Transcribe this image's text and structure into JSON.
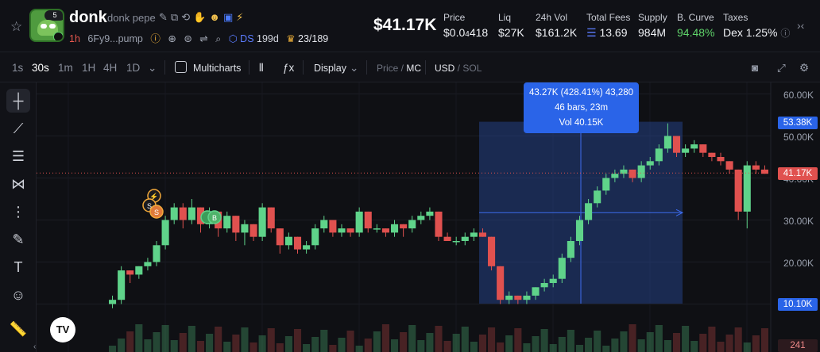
{
  "token": {
    "name": "donk",
    "full_name": "donk pepe",
    "avatar_badge": "5",
    "age": "1h",
    "address": "6Fy9...pump",
    "dex_label": "DS",
    "dex_value": "199d",
    "holders": "23/189"
  },
  "market_cap": "$41.17K",
  "stats": [
    {
      "label": "Price",
      "value_main": "$0.0",
      "value_sub": "4",
      "value_tail": "418"
    },
    {
      "label": "Liq",
      "value": "$27K"
    },
    {
      "label": "24h Vol",
      "value": "$161.2K"
    },
    {
      "label": "Total Fees",
      "value": "13.69",
      "icon": "sol-icon"
    },
    {
      "label": "Supply",
      "value": "984M"
    },
    {
      "label": "B. Curve",
      "value": "94.48%",
      "color": "#5fd36a"
    },
    {
      "label": "Taxes",
      "value": "Dex 1.25%"
    }
  ],
  "toolbar": {
    "timeframes": [
      "1s",
      "30s",
      "1m",
      "1H",
      "4H",
      "1D"
    ],
    "active_timeframe": "30s",
    "multicharts": "Multicharts",
    "display": "Display",
    "price": "Price",
    "mc": "MC",
    "usd": "USD",
    "sol": "SOL"
  },
  "tooltip": {
    "line1": "43.27K (428.41%) 43,280",
    "line2": "46 bars, 23m",
    "line3": "Vol 40.15K"
  },
  "y_axis": {
    "ticks": [
      "60.00K",
      "50.00K",
      "40.00K",
      "30.00K",
      "20.00K"
    ],
    "tag_top": "53.38K",
    "tag_current": "41.17K",
    "tag_bottom": "10.10K",
    "tag_volume": "241"
  },
  "chart_data": {
    "type": "candlestick",
    "y_unit": "USD market cap (K)",
    "ylim": [
      0,
      65
    ],
    "range_measure": {
      "from": 10.1,
      "to": 53.38,
      "change": "43.27K (428.41%) 43,280",
      "bars": 46,
      "duration": "23m",
      "volume": "40.15K"
    },
    "current": 41.17,
    "candles": [
      [
        10,
        12,
        9,
        11
      ],
      [
        11,
        19,
        10,
        18
      ],
      [
        18,
        17,
        15,
        17
      ],
      [
        17,
        19,
        16,
        19
      ],
      [
        19,
        21,
        18,
        20
      ],
      [
        20,
        25,
        19,
        24
      ],
      [
        24,
        31,
        23,
        30
      ],
      [
        30,
        34,
        29,
        33
      ],
      [
        33,
        34,
        28,
        30
      ],
      [
        30,
        35,
        29,
        33
      ],
      [
        33,
        30,
        27,
        29
      ],
      [
        29,
        33,
        28,
        32
      ],
      [
        32,
        30,
        26,
        28
      ],
      [
        28,
        32,
        27,
        31
      ],
      [
        31,
        28,
        25,
        27
      ],
      [
        27,
        30,
        24,
        29
      ],
      [
        29,
        26,
        25,
        26
      ],
      [
        26,
        34,
        25,
        33
      ],
      [
        33,
        29,
        27,
        28
      ],
      [
        28,
        26,
        22,
        24
      ],
      [
        24,
        27,
        23,
        26
      ],
      [
        26,
        23,
        22,
        23
      ],
      [
        23,
        25,
        22,
        24
      ],
      [
        24,
        29,
        23,
        28
      ],
      [
        28,
        31,
        27,
        30
      ],
      [
        30,
        27,
        26,
        27
      ],
      [
        27,
        29,
        26,
        28
      ],
      [
        28,
        27,
        26,
        27
      ],
      [
        27,
        33,
        26,
        32
      ],
      [
        32,
        28,
        27,
        28
      ],
      [
        28,
        29,
        27,
        28
      ],
      [
        28,
        27,
        26,
        27
      ],
      [
        27,
        30,
        26,
        29
      ],
      [
        29,
        28,
        26,
        28
      ],
      [
        28,
        31,
        27,
        30
      ],
      [
        30,
        32,
        29,
        31
      ],
      [
        31,
        33,
        30,
        32
      ],
      [
        32,
        28,
        25,
        26
      ],
      [
        26,
        27,
        25,
        25
      ],
      [
        25,
        26,
        24,
        25
      ],
      [
        25,
        27,
        24,
        26
      ],
      [
        26,
        28,
        25,
        27
      ],
      [
        27,
        28,
        26,
        26
      ],
      [
        26,
        24,
        18,
        19
      ],
      [
        19,
        13,
        10,
        11
      ],
      [
        11,
        13,
        10,
        12
      ],
      [
        12,
        12,
        10,
        11
      ],
      [
        11,
        13,
        10,
        12
      ],
      [
        12,
        14,
        11,
        14
      ],
      [
        14,
        16,
        13,
        15
      ],
      [
        15,
        17,
        14,
        16
      ],
      [
        16,
        22,
        15,
        21
      ],
      [
        21,
        26,
        20,
        25
      ],
      [
        25,
        31,
        24,
        30
      ],
      [
        30,
        35,
        29,
        34
      ],
      [
        34,
        38,
        33,
        37
      ],
      [
        37,
        41,
        36,
        40
      ],
      [
        40,
        42,
        39,
        41
      ],
      [
        41,
        43,
        40,
        42
      ],
      [
        42,
        41,
        39,
        40
      ],
      [
        40,
        44,
        39,
        43
      ],
      [
        43,
        45,
        42,
        44
      ],
      [
        44,
        48,
        43,
        47
      ],
      [
        47,
        53,
        46,
        50
      ],
      [
        50,
        49,
        45,
        46
      ],
      [
        46,
        48,
        45,
        47
      ],
      [
        47,
        49,
        46,
        48
      ],
      [
        48,
        47,
        45,
        46
      ],
      [
        46,
        45,
        44,
        45
      ],
      [
        45,
        46,
        43,
        44
      ],
      [
        44,
        43,
        41,
        42
      ],
      [
        42,
        41,
        30,
        32
      ],
      [
        32,
        44,
        28,
        43
      ],
      [
        43,
        44,
        41,
        42
      ],
      [
        42,
        43,
        41,
        41
      ]
    ]
  }
}
